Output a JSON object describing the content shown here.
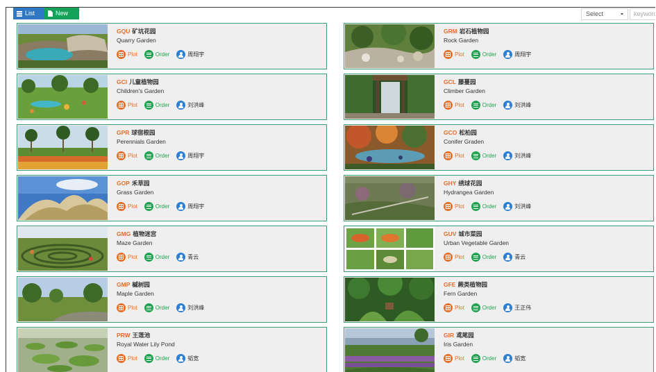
{
  "toolbar": {
    "list_label": "List",
    "new_label": "New",
    "select_value": "Select",
    "keyword_placeholder": "keyword"
  },
  "action_labels": {
    "plot": "Plot",
    "order": "Order"
  },
  "colors": {
    "primary_blue": "#2f78c4",
    "new_green": "#15a157",
    "code_orange": "#e56d29",
    "plot_orange": "#e66f2a",
    "order_green": "#21a351",
    "user_blue": "#2c7fd3",
    "card_border": "#3e9b73",
    "card_bg": "#efefef"
  },
  "gardens": [
    {
      "code": "GQU",
      "name_cn": "矿坑花园",
      "name_en": "Quarry Garden",
      "person": "周翔宇",
      "thumb": "quarry"
    },
    {
      "code": "GRM",
      "name_cn": "岩石植物园",
      "name_en": "Rock Garden",
      "person": "周翔宇",
      "thumb": "rock"
    },
    {
      "code": "GCI",
      "name_cn": "儿童植物园",
      "name_en": "Children's Garden",
      "person": "刘洪峰",
      "thumb": "children"
    },
    {
      "code": "GCL",
      "name_cn": "藤蔓园",
      "name_en": "Climber Garden",
      "person": "刘洪峰",
      "thumb": "climber"
    },
    {
      "code": "GPR",
      "name_cn": "球宿根园",
      "name_en": "Perennials Garden",
      "person": "周翔宇",
      "thumb": "perennials"
    },
    {
      "code": "GCO",
      "name_cn": "松柏园",
      "name_en": "Conifer Graden",
      "person": "刘洪峰",
      "thumb": "conifer"
    },
    {
      "code": "GOP",
      "name_cn": "禾草园",
      "name_en": "Grass Garden",
      "person": "周翔宇",
      "thumb": "grass"
    },
    {
      "code": "GHY",
      "name_cn": "绣球花园",
      "name_en": "Hydrangea Garden",
      "person": "刘洪峰",
      "thumb": "hydrangea"
    },
    {
      "code": "GMG",
      "name_cn": "植物迷宫",
      "name_en": "Maze Garden",
      "person": "青云",
      "thumb": "maze"
    },
    {
      "code": "GUV",
      "name_cn": "城市菜园",
      "name_en": "Urban Vegetable Garden",
      "person": "青云",
      "thumb": "vegetable"
    },
    {
      "code": "GMP",
      "name_cn": "槭树园",
      "name_en": "Maple Garden",
      "person": "刘洪峰",
      "thumb": "maple"
    },
    {
      "code": "GFE",
      "name_cn": "蕨类植物园",
      "name_en": "Fern Garden",
      "person": "王正伟",
      "thumb": "fern"
    },
    {
      "code": "PRW",
      "name_cn": "王莲池",
      "name_en": "Royal Water Lily Pond",
      "person": "韬宽",
      "thumb": "lily"
    },
    {
      "code": "GIR",
      "name_cn": "鸢尾园",
      "name_en": "Iris Garden",
      "person": "韬宽",
      "thumb": "iris"
    }
  ]
}
